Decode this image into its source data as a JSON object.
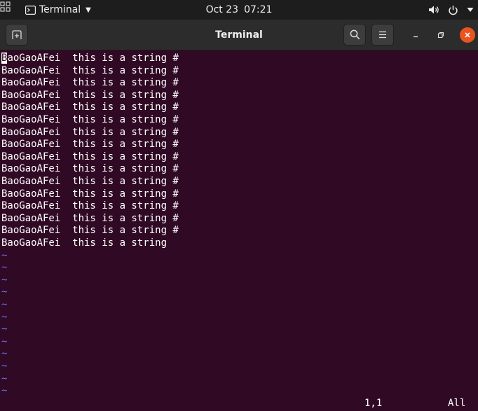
{
  "topbar": {
    "app_name": "Terminal",
    "date": "Oct 23",
    "time": "07:21",
    "icons": [
      "activities-icon",
      "terminal-app-icon",
      "caret-down-icon",
      "volume-icon",
      "power-icon",
      "system-menu-caret-icon"
    ]
  },
  "window": {
    "title": "Terminal",
    "new_tab_icon": "new-tab-icon",
    "search_icon": "search-icon",
    "menu_icon": "hamburger-menu-icon",
    "minimize_icon": "minimize-icon",
    "maximize_icon": "restore-icon",
    "close_icon": "close-icon",
    "close_color": "#e95420"
  },
  "editor": {
    "background": "#300a24",
    "tilde_color": "#6d6dff",
    "cursor_char": "B",
    "lines": [
      "aoGaoAFei  this is a string #",
      "BaoGaoAFei  this is a string #",
      "BaoGaoAFei  this is a string #",
      "BaoGaoAFei  this is a string #",
      "BaoGaoAFei  this is a string #",
      "BaoGaoAFei  this is a string #",
      "BaoGaoAFei  this is a string #",
      "BaoGaoAFei  this is a string #",
      "BaoGaoAFei  this is a string #",
      "BaoGaoAFei  this is a string #",
      "BaoGaoAFei  this is a string #",
      "BaoGaoAFei  this is a string #",
      "BaoGaoAFei  this is a string #",
      "BaoGaoAFei  this is a string #",
      "BaoGaoAFei  this is a string #",
      "BaoGaoAFei  this is a string"
    ],
    "tildes": [
      "~",
      "~",
      "~",
      "~",
      "~",
      "~",
      "~",
      "~",
      "~",
      "~",
      "~",
      "~"
    ],
    "status": {
      "position": "1,1",
      "scroll": "All"
    }
  }
}
